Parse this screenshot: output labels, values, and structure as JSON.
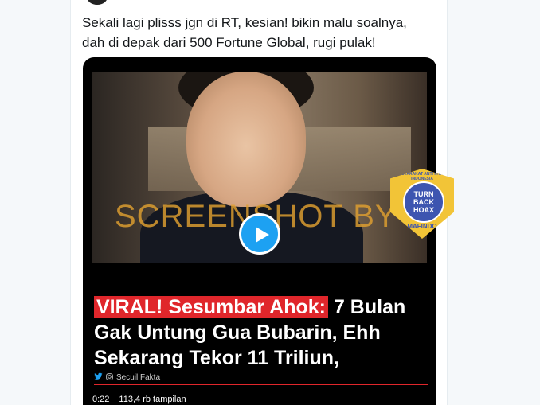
{
  "tweet": {
    "text_line1": "Sekali lagi plisss jgn di RT, kesian! bikin malu soalnya,",
    "text_line2": "dah di depak dari 500 Fortune Global, rugi pulak!"
  },
  "video": {
    "watermark": "SCREENSHOT BY",
    "headline_viral": "VIRAL! Sesumbar Ahok:",
    "headline_rest1": " 7 Bulan",
    "headline_line2": "Gak Untung Gua Bubarin, Ehh",
    "headline_line3": "Sekarang Tekor 11 Triliun,",
    "source": "Secuil Fakta",
    "duration": "0:22",
    "views": "113,4 rb tampilan"
  },
  "badge": {
    "ring_text": "MASYARAKAT ANTI FITNAH INDONESIA",
    "line1": "TURN",
    "line2": "BACK",
    "line3": "HOAX",
    "bottom_text": "MAFINDO"
  },
  "colors": {
    "accent": "#1da1f2",
    "viral_red": "#e0262b",
    "watermark": "#e0a030",
    "badge_yellow": "#f2c437",
    "badge_blue": "#3d55b0"
  },
  "icons": [
    "play-icon",
    "twitter-icon",
    "instagram-icon"
  ]
}
